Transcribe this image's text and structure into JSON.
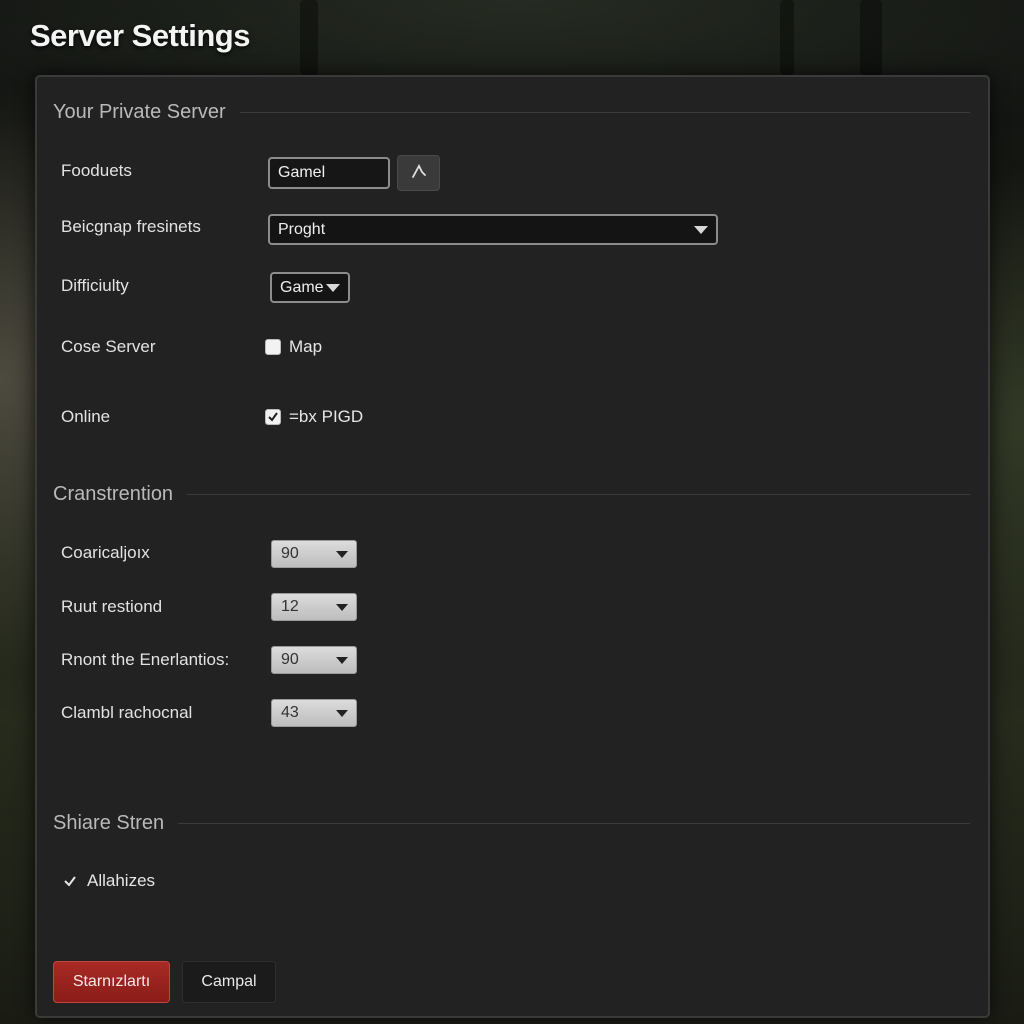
{
  "window": {
    "title": "Server Settings"
  },
  "sections": {
    "private_server": {
      "header": "Your Private Server",
      "rows": {
        "products": {
          "label": "Fooduets",
          "input_value": "Gamel"
        },
        "background": {
          "label": "Beicgnap fresinets",
          "select_value": "Proght"
        },
        "difficulty": {
          "label": "Difficiulty",
          "select_value": "Game"
        },
        "close_server": {
          "label": "Cose Server",
          "checkbox_label": "Map",
          "checked": false
        },
        "online": {
          "label": "Online",
          "checkbox_label": "=bx PIGD",
          "checked": true
        }
      }
    },
    "construction": {
      "header": "Cranstrention",
      "rows": [
        {
          "label": "Coaricaljoıx",
          "value": "90"
        },
        {
          "label": "Ruut restiond",
          "value": "12"
        },
        {
          "label": "Rnont the Enerlantios:",
          "value": "90"
        },
        {
          "label": "Clambl rachocnal",
          "value": "43"
        }
      ]
    },
    "share": {
      "header": "Shiare Stren",
      "check_label": "Allahizes",
      "checked": true
    }
  },
  "buttons": {
    "primary_label": "Starnızlartı",
    "secondary_label": "Campal"
  },
  "icons": {
    "browse": "pick-icon",
    "dropdown": "chevron-down-icon",
    "check": "check-icon"
  },
  "colors": {
    "panel_bg": "#222222",
    "primary_button": "#9a2420",
    "accent_text": "#e6e6e6"
  }
}
